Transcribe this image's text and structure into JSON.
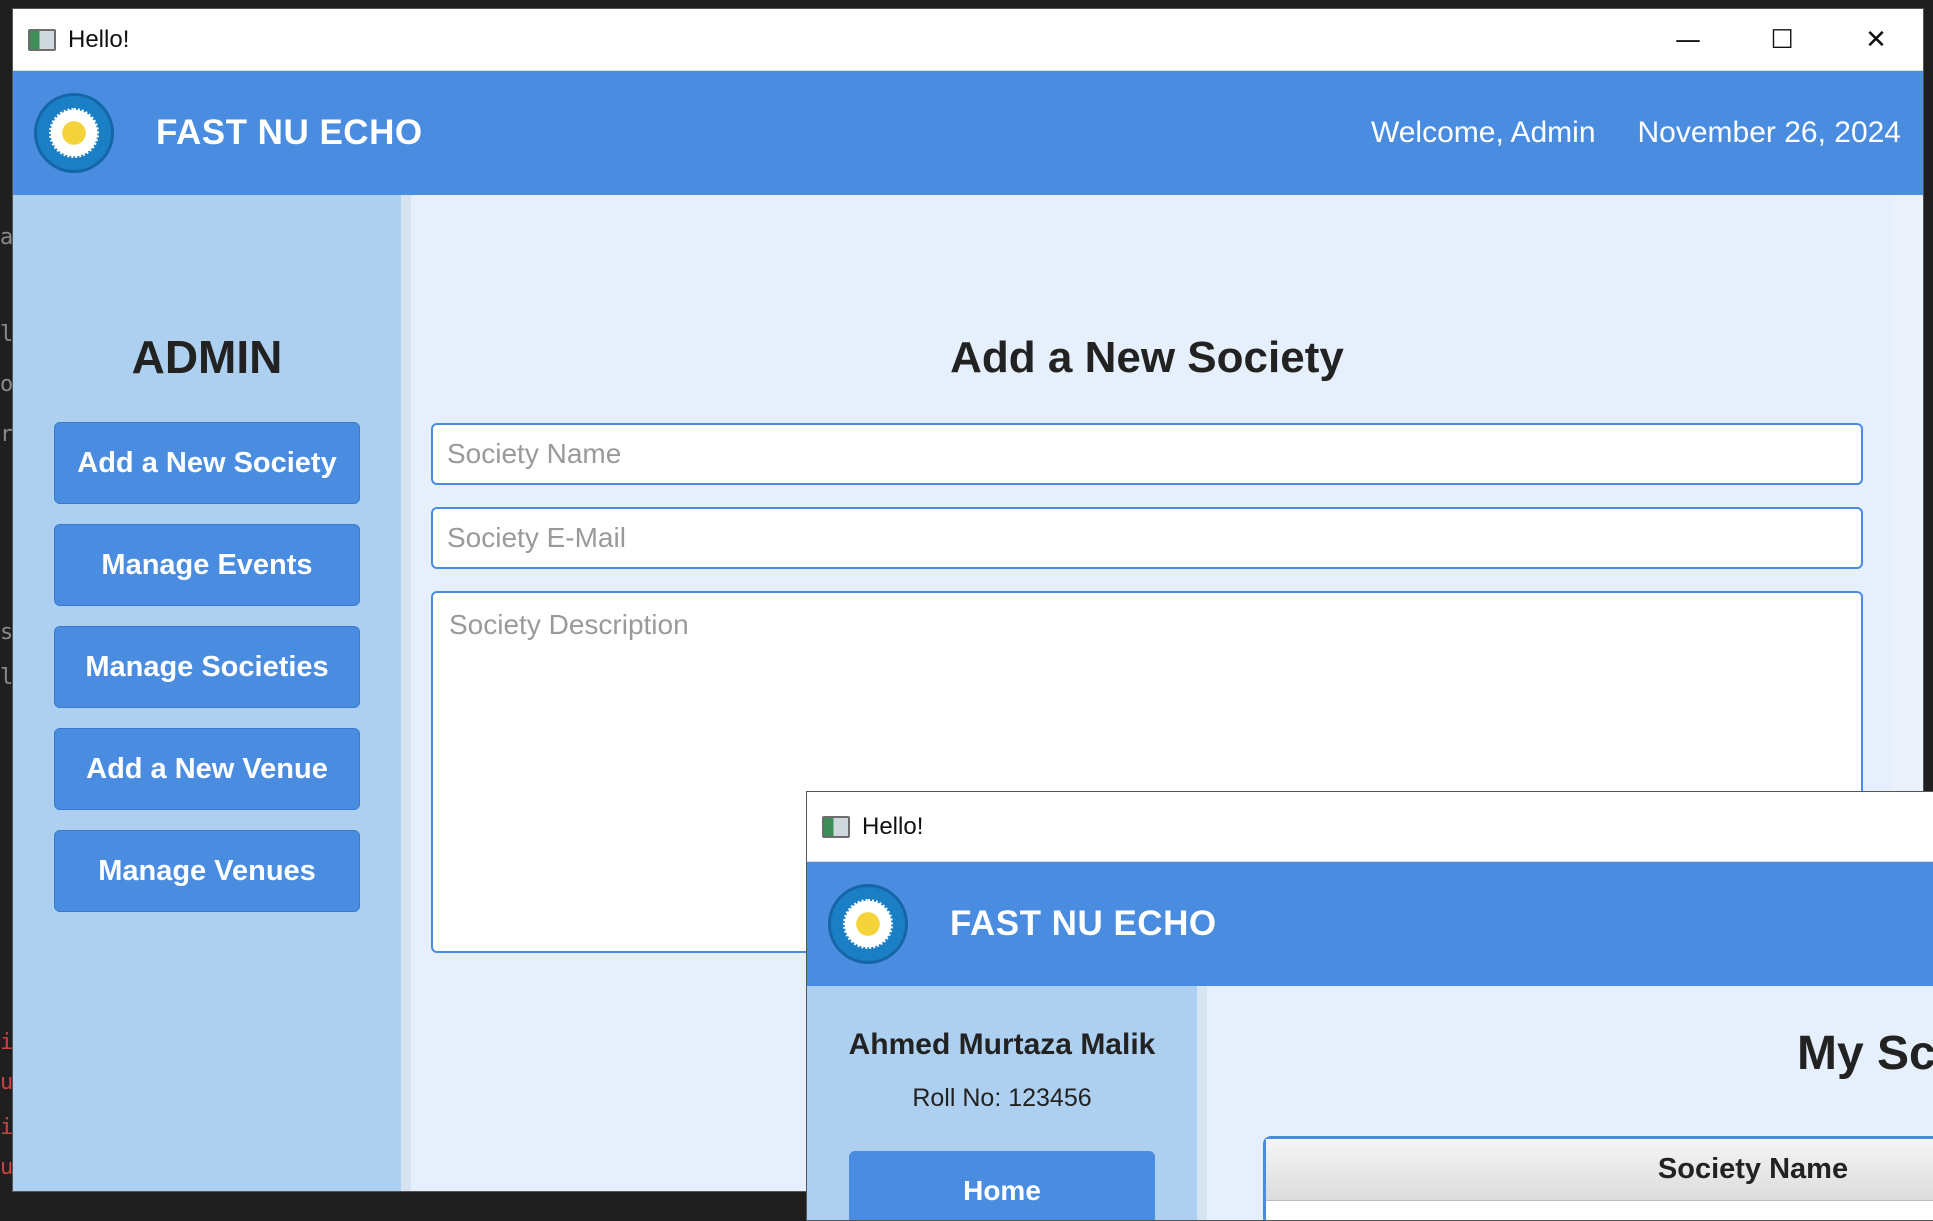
{
  "window": {
    "title": "Hello!",
    "controls": {
      "minimize": "—",
      "maximize": "☐",
      "close": "✕"
    }
  },
  "header": {
    "brand": "FAST NU ECHO",
    "welcome": "Welcome, Admin",
    "date": "November 26, 2024"
  },
  "sidebar": {
    "title": "ADMIN",
    "items": [
      {
        "label": "Add a New Society"
      },
      {
        "label": "Manage Events"
      },
      {
        "label": "Manage Societies"
      },
      {
        "label": "Add a New Venue"
      },
      {
        "label": "Manage Venues"
      }
    ]
  },
  "form": {
    "title": "Add a New Society",
    "name_placeholder": "Society Name",
    "email_placeholder": "Society E-Mail",
    "description_placeholder": "Society Description"
  },
  "window2": {
    "title": "Hello!",
    "brand": "FAST NU ECHO",
    "profile_name": "Ahmed Murtaza Malik",
    "roll": "Roll No: 123456",
    "home_label": "Home",
    "main_title": "My Sc",
    "table_header": "Society Name"
  },
  "colors": {
    "accent": "#4a8de0",
    "sidebar": "#aed0f0",
    "content_bg": "#e6f0fc"
  }
}
